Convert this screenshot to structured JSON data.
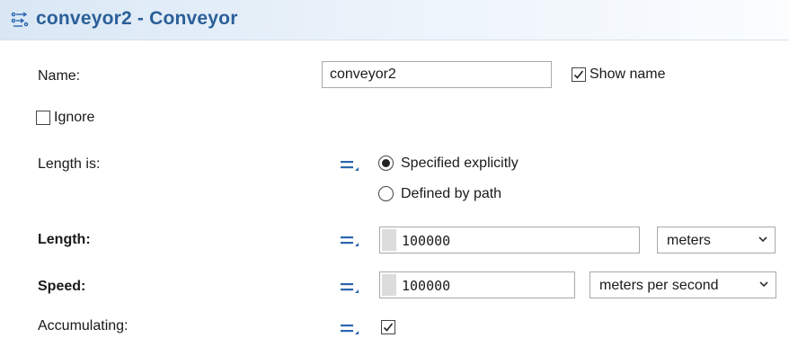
{
  "header": {
    "title": "conveyor2 - Conveyor",
    "icon": "conveyor-icon"
  },
  "form": {
    "name_label": "Name:",
    "name_value": "conveyor2",
    "show_name_label": "Show name",
    "show_name_checked": true,
    "ignore_label": "Ignore",
    "ignore_checked": false,
    "length_is_label": "Length is:",
    "length_is_options": [
      "Specified explicitly",
      "Defined by path"
    ],
    "length_is_selected": "Specified explicitly",
    "length_label": "Length:",
    "length_value": "100000",
    "length_unit": "meters",
    "speed_label": "Speed:",
    "speed_value": "100000",
    "speed_unit": "meters per second",
    "accumulating_label": "Accumulating:",
    "accumulating_checked": true
  },
  "colors": {
    "title": "#2a5f98",
    "icon_accent": "#2a66b0"
  }
}
